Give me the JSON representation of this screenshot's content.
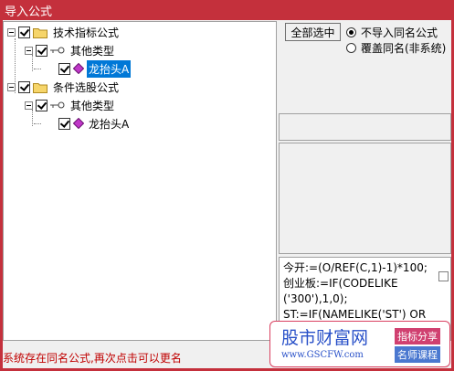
{
  "window": {
    "title": "导入公式"
  },
  "tree": {
    "groups": [
      {
        "label": "技术指标公式",
        "checked": true,
        "category": {
          "label": "其他类型",
          "checked": true,
          "item": {
            "label": "龙抬头A",
            "checked": true,
            "selected": true
          }
        }
      },
      {
        "label": "条件选股公式",
        "checked": true,
        "category": {
          "label": "其他类型",
          "checked": true,
          "item": {
            "label": "龙抬头A",
            "checked": true,
            "selected": false
          }
        }
      }
    ]
  },
  "controls": {
    "select_all_label": "全部选中",
    "radio_options": [
      {
        "label": "不导入同名公式",
        "checked": true
      },
      {
        "label": "覆盖同名(非系统)",
        "checked": false
      }
    ]
  },
  "code_preview": {
    "lines": [
      "今开:=(O/REF(C,1)-1)*100;",
      "创业板:=IF(CODELIKE",
      "('300'),1,0);",
      "ST:=IF(NAMELIKE('ST') OR"
    ]
  },
  "status_message": "系统存在同名公式,再次点击可以更名",
  "watermark": {
    "name": "股市财富网",
    "url": "www.GSCFW.com",
    "tag1": "指标分享",
    "tag2": "名师课程"
  },
  "colors": {
    "title_bar": "#c4303c",
    "selection": "#0078d7",
    "status_text": "#c00000"
  }
}
